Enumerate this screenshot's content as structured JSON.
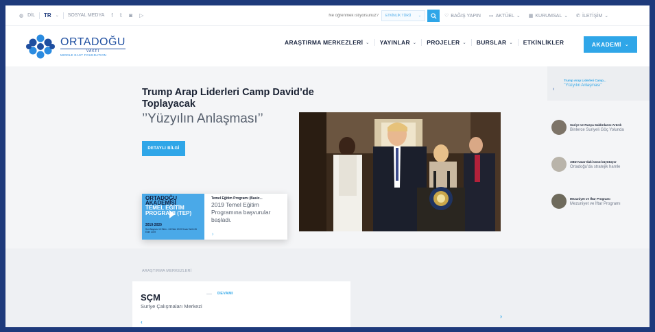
{
  "topbar": {
    "lang_label": "DİL",
    "lang_code": "TR",
    "social_label": "SOSYAL MEDYA",
    "social_icons": [
      "facebook-icon",
      "twitter-icon",
      "instagram-icon",
      "youtube-icon"
    ],
    "search_placeholder": "Ne öğrenmek istiyorsunuz?",
    "search_select": "ETKİNLİK TÜRÜ",
    "donate": "BAĞIŞ YAPIN",
    "current": "AKTÜEL",
    "corporate": "KURUMSAL",
    "contact": "İLETİŞİM"
  },
  "logo": {
    "name": "ORTADOĞU",
    "sub": "VAKFI",
    "tagline": "MIDDLE EAST FOUNDATION"
  },
  "nav": {
    "items": [
      {
        "label": "ARAŞTIRMA MERKEZLERİ",
        "dropdown": true
      },
      {
        "label": "YAYINLAR",
        "dropdown": true
      },
      {
        "label": "PROJELER",
        "dropdown": true
      },
      {
        "label": "BURSLAR",
        "dropdown": true
      },
      {
        "label": "ETKİNLİKLER",
        "dropdown": false
      }
    ],
    "active": "AKADEMİ"
  },
  "hero": {
    "title": "Trump Arap Liderleri Camp David’de Toplayacak",
    "subtitle": "’’Yüzyılın Anlaşması’’",
    "button": "DETAYLI BİLGİ"
  },
  "promo": {
    "image_line1": "ORTADOĞU AKADEMİSİ",
    "image_line2": "TEMEL EĞİTİM PROGRAMI (TEP)",
    "image_line3": "2019-2020",
    "image_fine": "Son Başvuru 10 Ekim - 24 Ekim 2019 Sınav Tarihi 26 Ekim 2019",
    "title": "Temel Eğitim Programı (Basic...",
    "body": "2019 Temel Eğitim Programına başvurular başladı."
  },
  "side_slider": {
    "items": [
      {
        "title": "Trump Arap Liderleri Camp...",
        "subtitle": "’’Yüzyılın Anlaşması’’"
      },
      {
        "title": "Suriye ve Rusya Saldırılarını Artırdı",
        "subtitle": "Binlerce Suriyeli Göç Yolunda"
      },
      {
        "title": "ABD Katar’daki üssü büyütüyor",
        "subtitle": "Ortadoğu’da stratejik hamle"
      },
      {
        "title": "Mezuniyet ve İftar Programı",
        "subtitle": "Mezuniyet ve İftar Programı"
      }
    ]
  },
  "research": {
    "section_label": "ARAŞTIRMA MERKEZLERİ",
    "abbr": "SÇM",
    "name": "Suriye Çalışmaları Merkezi",
    "more": "DEVAMI"
  }
}
